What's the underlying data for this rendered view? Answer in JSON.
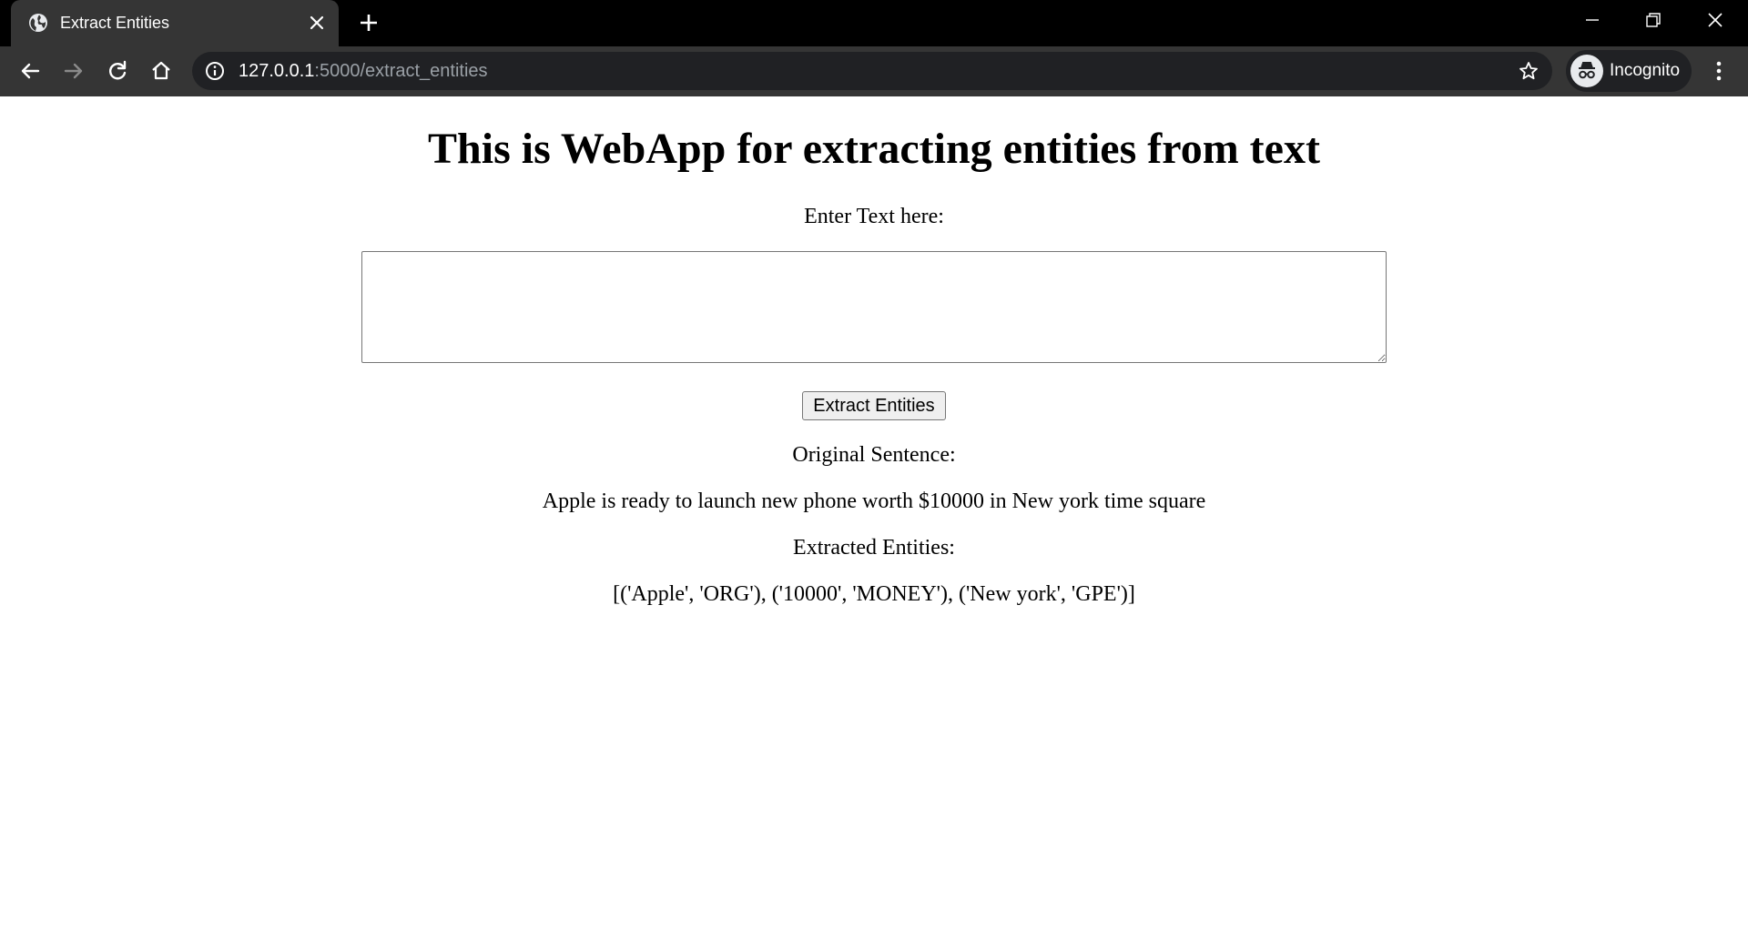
{
  "browser": {
    "tab_title": "Extract Entities",
    "url_host": "127.0.0.1",
    "url_rest": ":5000/extract_entities",
    "profile_label": "Incognito",
    "icons": [
      "globe-icon",
      "close-icon",
      "plus-icon",
      "minimize-icon",
      "restore-icon",
      "window-close-icon",
      "back-icon",
      "forward-icon",
      "reload-icon",
      "home-icon",
      "info-icon",
      "star-icon",
      "incognito-icon",
      "more-vert-icon"
    ]
  },
  "page": {
    "heading": "This is WebApp for extracting entities from text",
    "input_label": "Enter Text here:",
    "textarea_value": "",
    "button_label": "Extract Entities",
    "original_label": "Original Sentence:",
    "original_sentence": "Apple is ready to launch new phone worth $10000 in New york time square",
    "entities_label": "Extracted Entities:",
    "entities": "[('Apple', 'ORG'), ('10000', 'MONEY'), ('New york', 'GPE')]"
  }
}
